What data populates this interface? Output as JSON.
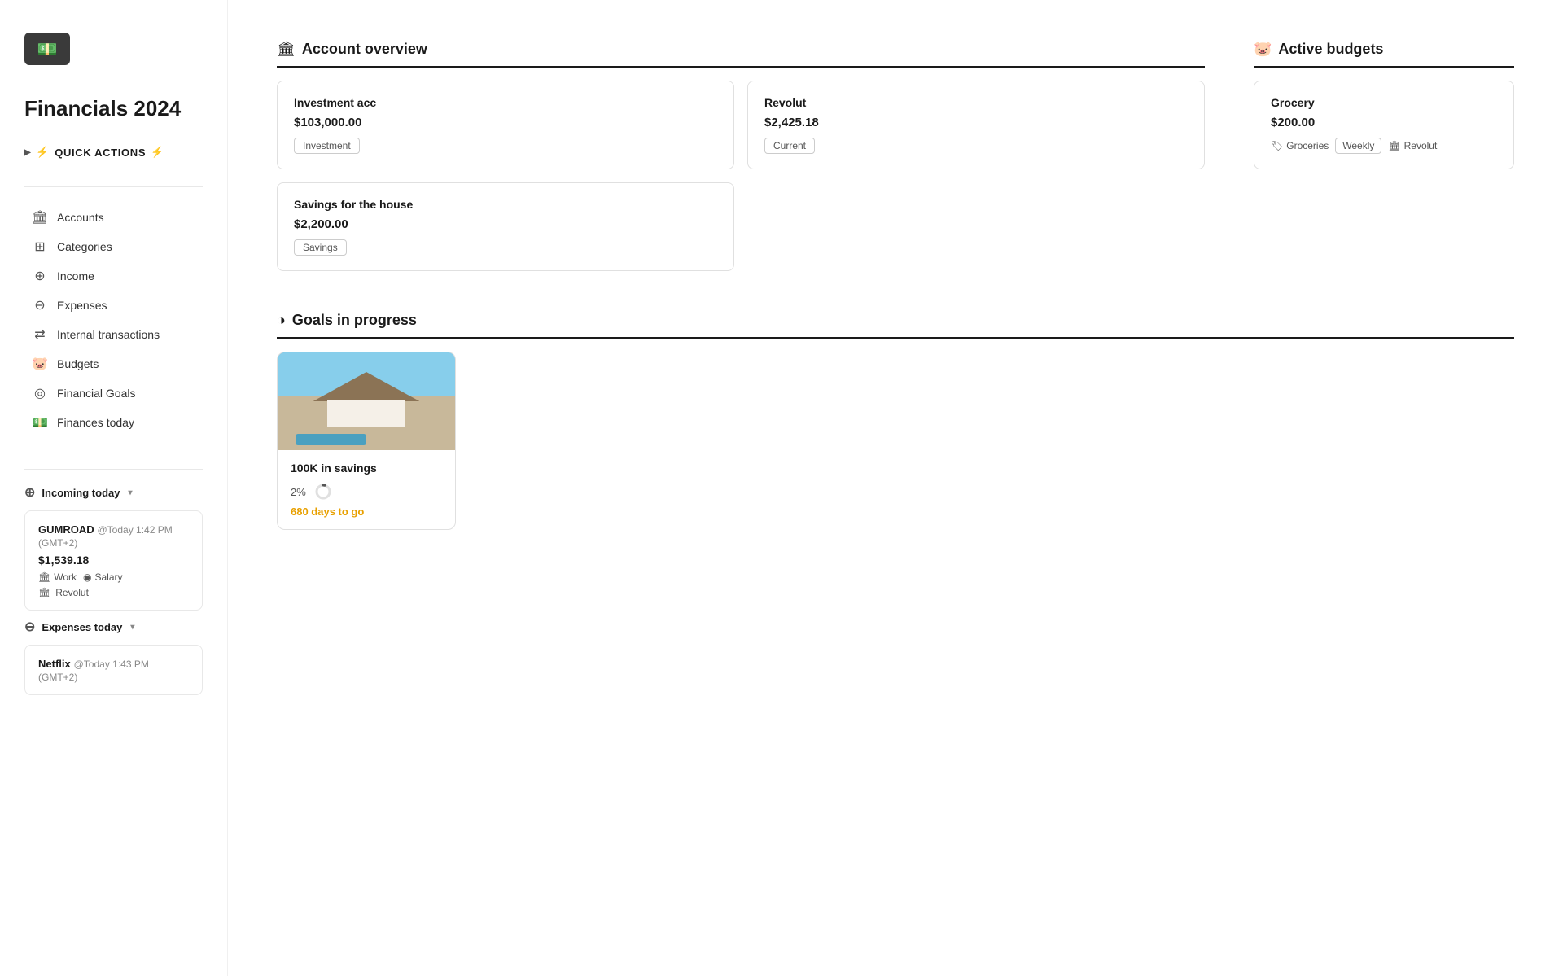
{
  "app": {
    "title": "Financials 2024",
    "logo_icon": "💵"
  },
  "quick_actions": {
    "label": "QUICK ACTIONS",
    "lightning": "⚡"
  },
  "nav": {
    "items": [
      {
        "id": "accounts",
        "icon": "🏛",
        "label": "Accounts"
      },
      {
        "id": "categories",
        "icon": "⊞",
        "label": "Categories"
      },
      {
        "id": "income",
        "icon": "⊕",
        "label": "Income"
      },
      {
        "id": "expenses",
        "icon": "⊖",
        "label": "Expenses"
      },
      {
        "id": "internal-transactions",
        "icon": "⇄",
        "label": "Internal transactions"
      },
      {
        "id": "budgets",
        "icon": "🐷",
        "label": "Budgets"
      },
      {
        "id": "financial-goals",
        "icon": "◎",
        "label": "Financial Goals"
      },
      {
        "id": "finances-today",
        "icon": "💵",
        "label": "Finances today"
      }
    ]
  },
  "incoming_today": {
    "header": "Incoming today",
    "transactions": [
      {
        "title": "GUMROAD",
        "time": "@Today 1:42 PM (GMT+2)",
        "amount": "$1,539.18",
        "tags": [
          {
            "icon": "🏛",
            "label": "Work"
          },
          {
            "icon": "◉",
            "label": "Salary"
          }
        ],
        "account": {
          "icon": "🏛",
          "label": "Revolut"
        }
      }
    ]
  },
  "expenses_today": {
    "header": "Expenses today",
    "transactions": [
      {
        "title": "Netflix",
        "time": "@Today 1:43 PM (GMT+2)",
        "amount": ""
      }
    ]
  },
  "account_overview": {
    "title": "Account overview",
    "icon": "🏛",
    "accounts": [
      {
        "name": "Investment acc",
        "amount": "$103,000.00",
        "type": "Investment"
      },
      {
        "name": "Revolut",
        "amount": "$2,425.18",
        "type": "Current"
      },
      {
        "name": "Savings for the house",
        "amount": "$2,200.00",
        "type": "Savings"
      }
    ]
  },
  "active_budgets": {
    "title": "Active budgets",
    "icon": "🐷",
    "budgets": [
      {
        "name": "Grocery",
        "amount": "$200.00",
        "category_icon": "🏷",
        "category": "Groceries",
        "period": "Weekly",
        "account_icon": "🏛",
        "account": "Revolut"
      }
    ]
  },
  "goals_in_progress": {
    "title": "Goals in progress",
    "icon": "◑",
    "goals": [
      {
        "name": "100K in savings",
        "percent": "2%",
        "days_to_go": "680 days to go"
      }
    ]
  }
}
